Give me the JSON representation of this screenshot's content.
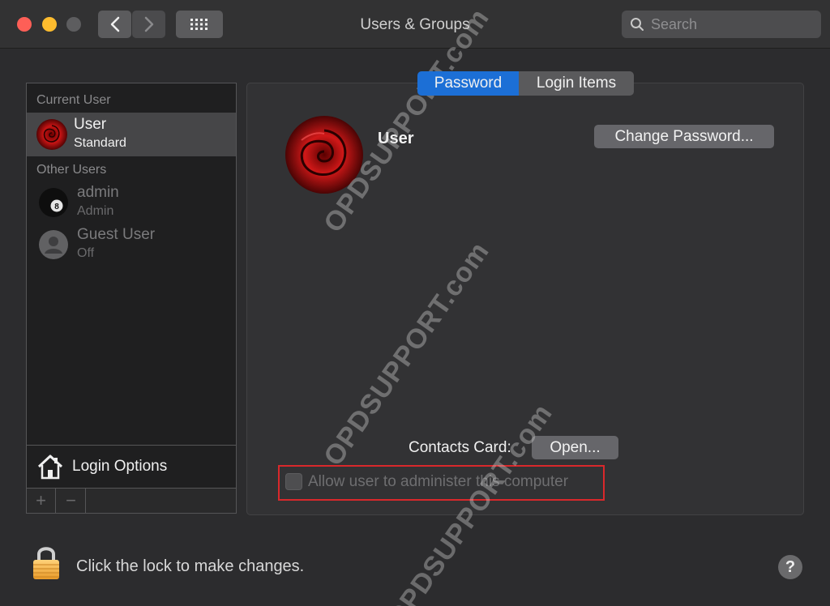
{
  "window": {
    "title": "Users & Groups",
    "search_placeholder": "Search"
  },
  "sidebar": {
    "current_user_label": "Current User",
    "current_user": {
      "name": "User",
      "role": "Standard",
      "avatar": "red-rose"
    },
    "other_users_label": "Other Users",
    "other_users": [
      {
        "name": "admin",
        "role": "Admin",
        "avatar": "eight-ball"
      },
      {
        "name": "Guest User",
        "role": "Off",
        "avatar": "generic-person"
      }
    ],
    "login_options_label": "Login Options",
    "add_symbol": "+",
    "remove_symbol": "−"
  },
  "tabs": [
    {
      "label": "Password",
      "active": true
    },
    {
      "label": "Login Items",
      "active": false
    }
  ],
  "main": {
    "username": "User",
    "change_password_label": "Change Password...",
    "contacts_card_label": "Contacts Card:",
    "open_label": "Open...",
    "admin_checkbox_label": "Allow user to administer this computer",
    "admin_checked": false
  },
  "footer": {
    "lock_text": "Click the lock to make changes.",
    "help_symbol": "?"
  },
  "watermark": "OPDSUPPORT.com",
  "colors": {
    "accent": "#1c6fd6",
    "highlight_border": "#d9282b"
  }
}
